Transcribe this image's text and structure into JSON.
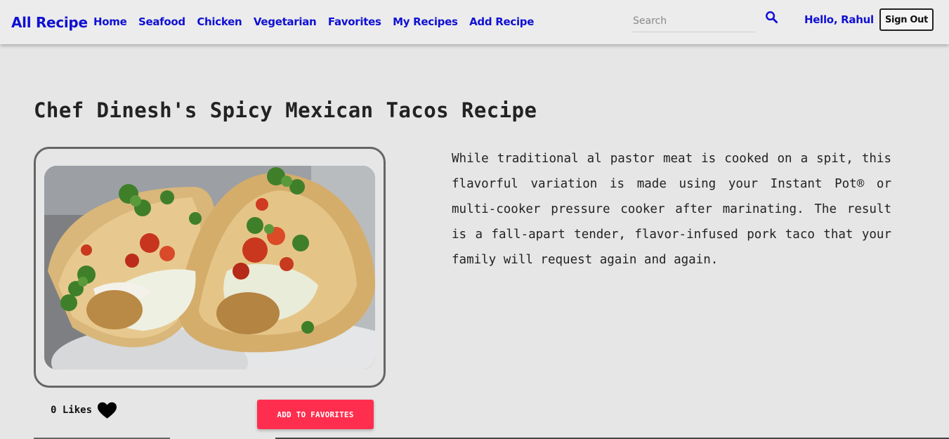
{
  "navbar": {
    "brand": "All Recipe",
    "links": [
      "Home",
      "Seafood",
      "Chicken",
      "Vegetarian",
      "Favorites",
      "My Recipes",
      "Add Recipe"
    ],
    "search_placeholder": "Search",
    "search_icon": "search-icon",
    "greeting": "Hello, Rahul",
    "signout_label": "Sign Out"
  },
  "recipe": {
    "title": "Chef Dinesh's Spicy Mexican Tacos Recipe",
    "image_alt": "Tacos with cilantro, cabbage, salsa and crema on a white plate",
    "description": "While traditional al pastor meat is cooked on a spit, this flavorful variation is made using your Instant Pot® or multi-cooker pressure cooker after marinating. The result is a fall-apart tender, flavor-infused pork taco that your family will request again and again.",
    "likes_label": "0 Likes",
    "heart_icon": "heart-icon",
    "favorite_button_label": "ADD TO FAVORITES"
  },
  "colors": {
    "link": "#1010d4",
    "background": "#e6e6e6",
    "favorite_button": "#ff2e4f"
  }
}
